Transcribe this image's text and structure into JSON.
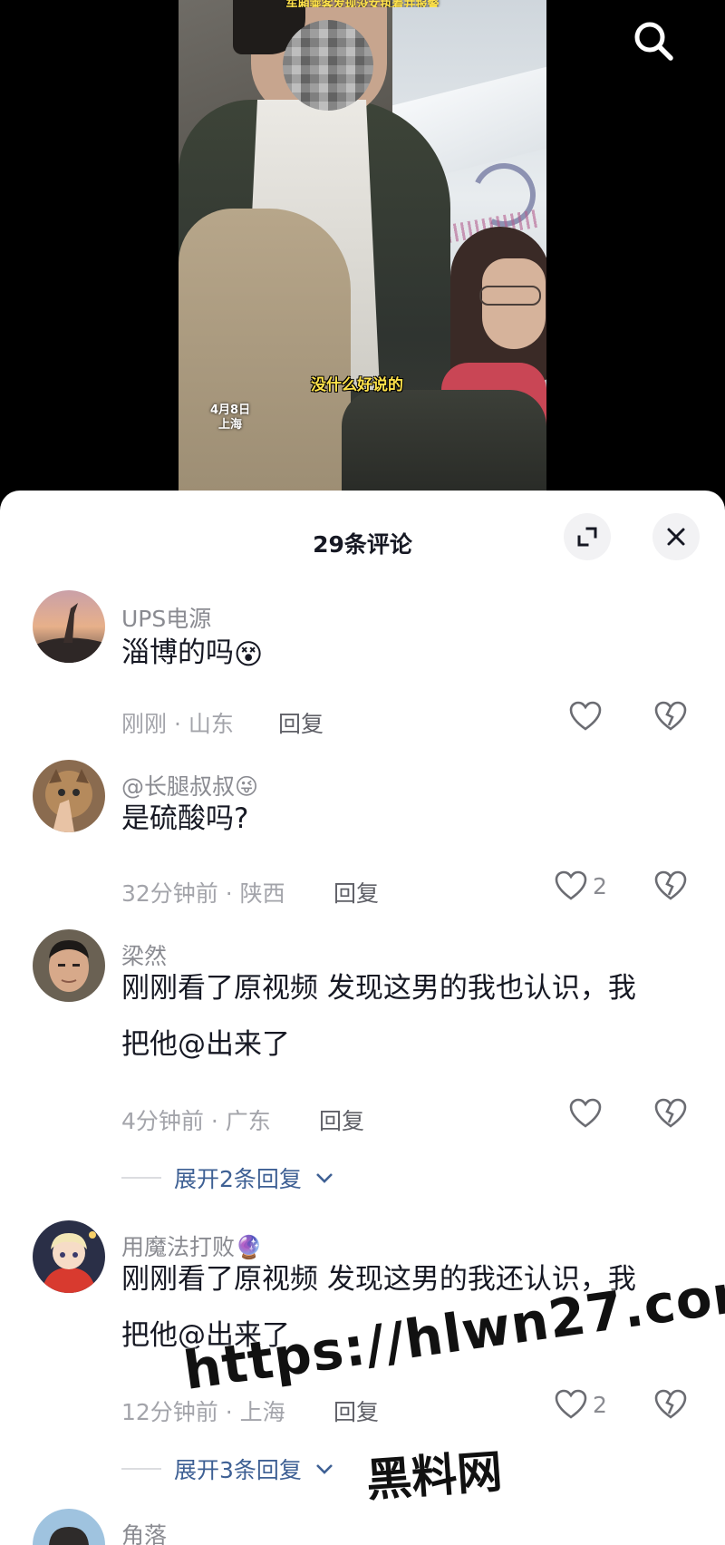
{
  "video": {
    "caption_top": "车厢乘客发现没女执着并报警",
    "subtitle": "没什么好说的",
    "date": "4月8日",
    "location": "上海"
  },
  "toolbar": {
    "search_icon": "search-icon"
  },
  "comments_panel": {
    "title": "29条评论",
    "expand_icon": "expand-icon",
    "close_icon": "close-icon"
  },
  "comments": [
    {
      "username": "UPS电源",
      "text": "淄博的吗",
      "emoji": "😵",
      "time_location": "刚刚 · 山东",
      "reply_label": "回复",
      "likes": ""
    },
    {
      "username": "@长腿叔叔",
      "username_emoji": "😜",
      "text": "是硫酸吗?",
      "time_location": "32分钟前 · 陕西",
      "reply_label": "回复",
      "likes": "2"
    },
    {
      "username": "梁然",
      "text_line1": "刚刚看了原视频 发现这男的我也认识，我",
      "text_line2": "把他@出来了",
      "time_location": "4分钟前 · 广东",
      "reply_label": "回复",
      "likes": "",
      "expand_label": "展开2条回复"
    },
    {
      "username": "用魔法打败",
      "username_emoji": "🔮",
      "text_line1": "刚刚看了原视频 发现这男的我还认识，我",
      "text_line2": "把他@出来了",
      "time_location": "12分钟前 · 上海",
      "reply_label": "回复",
      "likes": "2",
      "expand_label": "展开3条回复"
    },
    {
      "username": "角落"
    }
  ],
  "watermark": {
    "url": "https://hlwn27.com",
    "name": "黑料网"
  }
}
